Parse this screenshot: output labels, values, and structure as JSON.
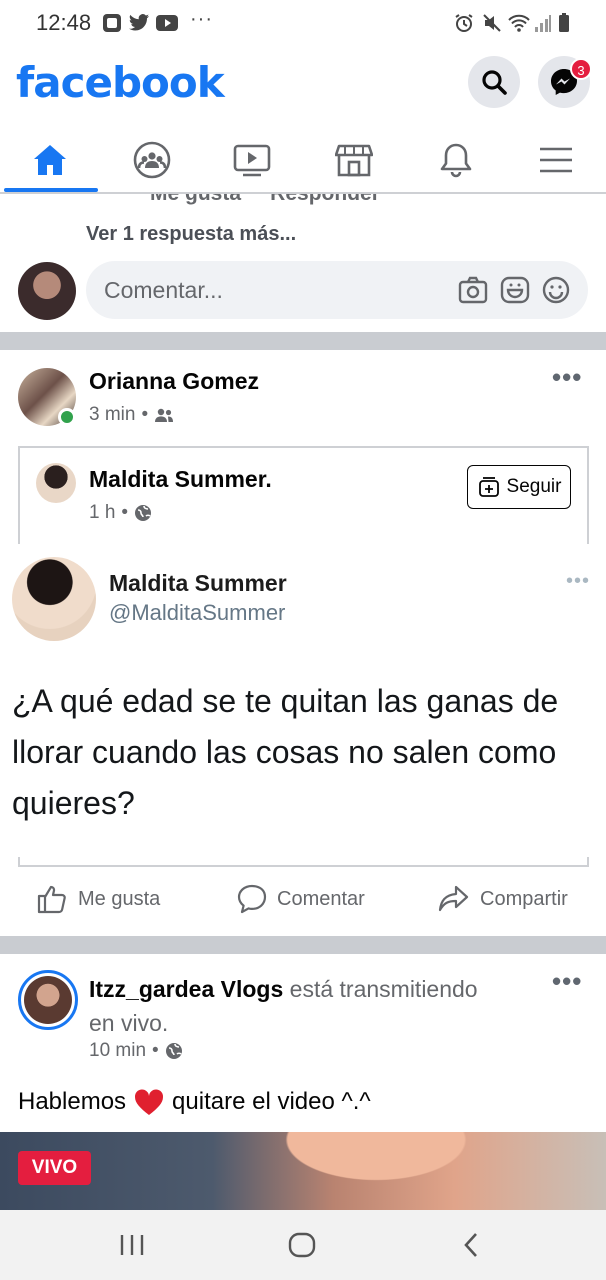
{
  "status_bar": {
    "time": "12:48",
    "more": "···"
  },
  "header": {
    "logo": "facebook",
    "messenger_badge": "3"
  },
  "tabs": [
    {
      "name": "home-icon"
    },
    {
      "name": "groups-icon"
    },
    {
      "name": "watch-icon"
    },
    {
      "name": "marketplace-icon"
    },
    {
      "name": "notifications-icon"
    },
    {
      "name": "menu-icon"
    }
  ],
  "prev_post": {
    "partial_actions": "Me gusta     Responder",
    "more_replies": "Ver 1 respuesta más...",
    "comment_placeholder": "Comentar..."
  },
  "post1": {
    "author": "Orianna Gomez",
    "time": "3 min",
    "shared": {
      "page_name": "Maldita Summer.",
      "time": "1 h",
      "follow_label": "Seguir",
      "tweet_name": "Maldita Summer",
      "tweet_handle": "@MalditaSummer",
      "tweet_text": "¿A qué edad se te quitan las ganas de llorar cuando las cosas no salen como quieres?"
    },
    "actions": {
      "like": "Me gusta",
      "comment": "Comentar",
      "share": "Compartir"
    }
  },
  "post2": {
    "author": "Itzz_gardea Vlogs",
    "status_line1": " está transmitiendo",
    "status_line2": "en vivo.",
    "time": "10 min",
    "text_before": "Hablemos",
    "text_after": "quitare el video ^.^",
    "live_badge": "VIVO"
  }
}
